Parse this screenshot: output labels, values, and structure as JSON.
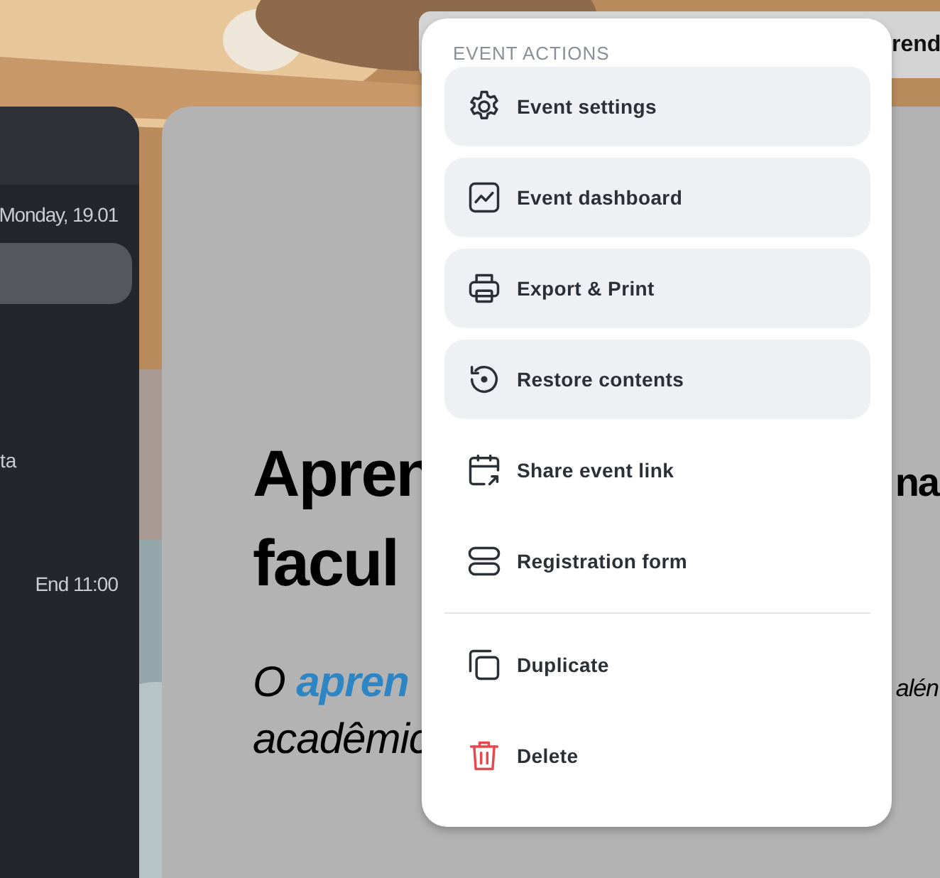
{
  "sidebar": {
    "date": "Monday, 19.01",
    "items": [
      {
        "selected": true
      }
    ],
    "fragment": "ta",
    "end_time": "End 11:00"
  },
  "top_bar": {
    "text": "rend"
  },
  "main_card": {
    "title_lines": [
      {
        "left": "Apren",
        "right": "na"
      },
      {
        "left": "facul"
      }
    ],
    "subtitle_lines": [
      {
        "left": "O **apren**",
        "right": "alén"
      },
      {
        "left": "acadêmic"
      }
    ]
  },
  "menu": {
    "header": "EVENT ACTIONS",
    "groups": [
      {
        "items": [
          {
            "label": "Event settings",
            "kind": "action",
            "highlighted": true
          },
          {
            "label": "Event dashboard",
            "kind": "action",
            "highlighted": true
          },
          {
            "label": "Export & Print",
            "kind": "action",
            "highlighted": true
          },
          {
            "label": "Restore contents",
            "kind": "action",
            "highlighted": true
          },
          {
            "label": "Share event link",
            "kind": "action",
            "highlighted": false
          },
          {
            "label": "Registration form",
            "kind": "action",
            "highlighted": false
          }
        ]
      },
      {
        "items": [
          {
            "label": "Duplicate",
            "kind": "action",
            "highlighted": false
          },
          {
            "label": "Delete",
            "kind": "danger",
            "highlighted": false
          }
        ]
      }
    ]
  }
}
